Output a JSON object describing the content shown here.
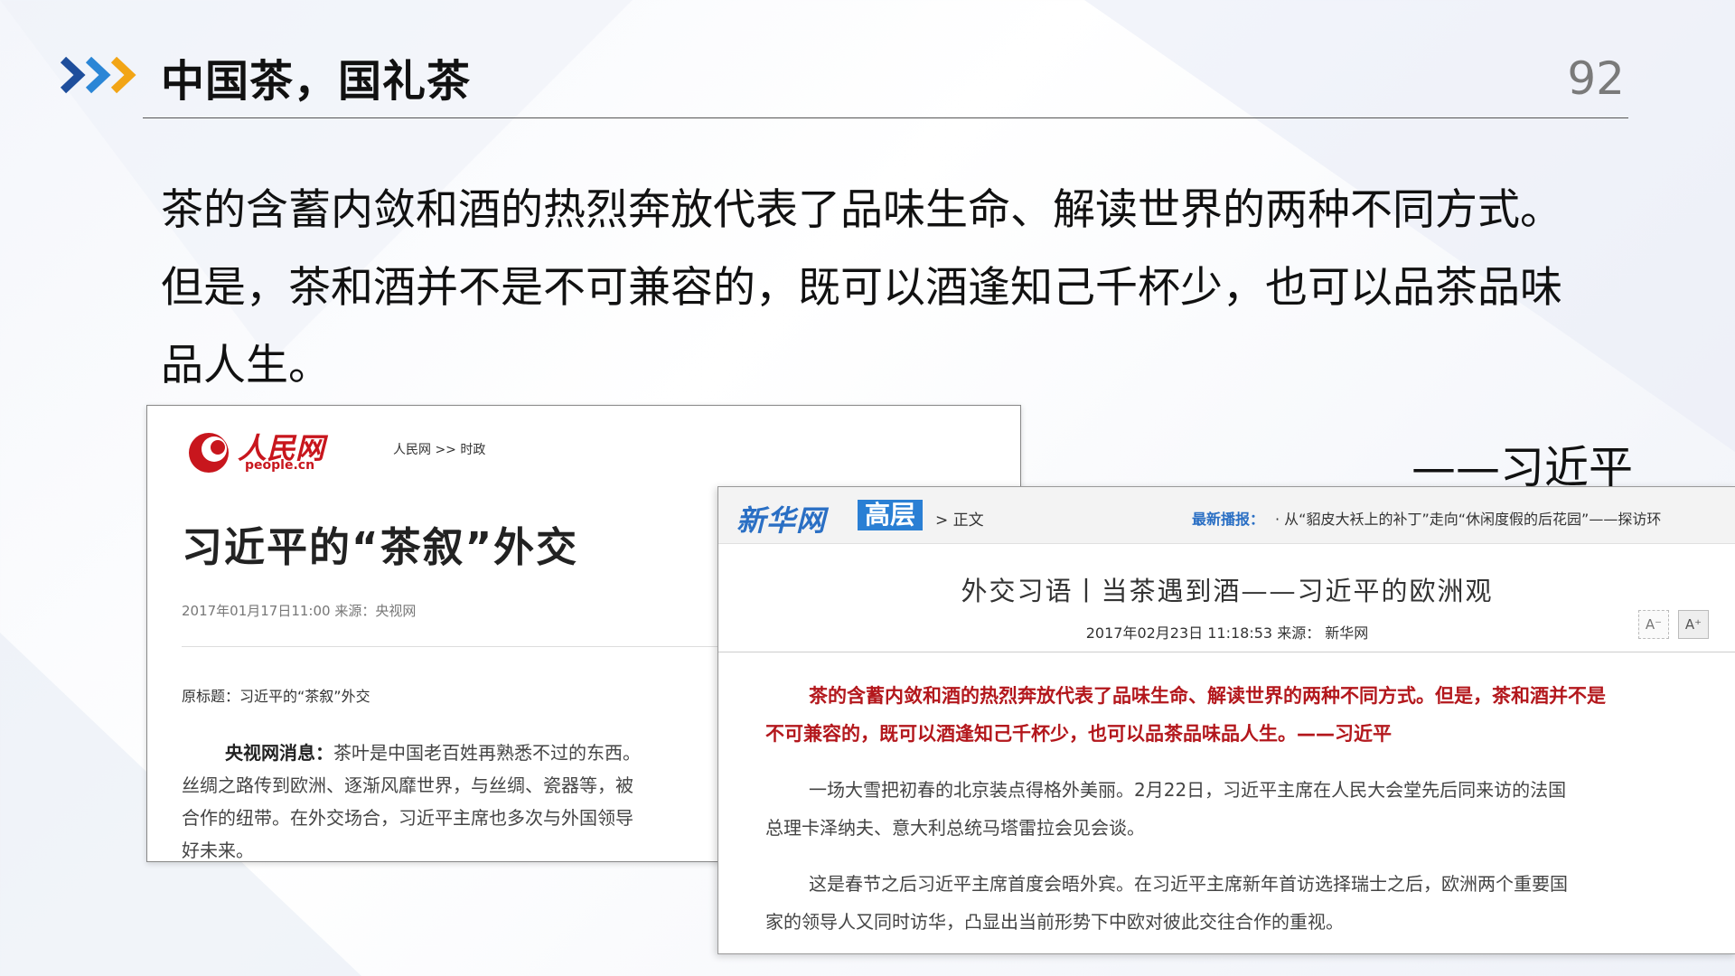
{
  "header": {
    "title": "中国茶，国礼茶",
    "page_number": "92"
  },
  "quote": {
    "line1": "茶的含蓄内敛和酒的热烈奔放代表了品味生命、解读世界的两种不同方式。",
    "line2": "但是，茶和酒并不是不可兼容的，既可以酒逢知己千杯少，也可以品茶品味",
    "line3": "品人生。",
    "attribution": "——习近平"
  },
  "people_card": {
    "logo_text": "人民网",
    "logo_domain": "people.cn",
    "breadcrumb": "人民网 >> 时政",
    "headline": "习近平的“茶叙”外交",
    "meta": "2017年01月17日11:00    来源：央视网",
    "original_title": "原标题：习近平的“茶叙”外交",
    "body_lead": "央视网消息：",
    "body_line1": "茶叶是中国老百姓再熟悉不过的东西。",
    "body_line2": "丝绸之路传到欧洲、逐渐风靡世界，与丝绸、瓷器等，被",
    "body_line3": "合作的纽带。在外交场合，习近平主席也多次与外国领导",
    "body_line4": "好未来。",
    "logo_color": "#c8161d"
  },
  "xinhua_card": {
    "logo": "新华网",
    "tag": "高层",
    "crumb": "> 正文",
    "news_label": "最新播报：",
    "news_text": "· 从“貂皮大袄上的补丁”走向“休闲度假的后花园”——探访环",
    "title": "外交习语丨当茶遇到酒——习近平的欧洲观",
    "meta": "2017年02月23日 11:18:53 来源： 新华网",
    "font_small": "A⁻",
    "font_big": "A⁺",
    "red_line1": "茶的含蓄内敛和酒的热烈奔放代表了品味生命、解读世界的两种不同方式。但是，茶和酒并不是",
    "red_line2": "不可兼容的，既可以酒逢知己千杯少，也可以品茶品味品人生。——习近平",
    "p1_line1": "一场大雪把初春的北京装点得格外美丽。2月22日，习近平主席在人民大会堂先后同来访的法国",
    "p1_line2": "总理卡泽纳夫、意大利总统马塔雷拉会见会谈。",
    "p2_line1": "这是春节之后习近平主席首度会晤外宾。在习近平主席新年首访选择瑞士之后，欧洲两个重要国",
    "p2_line2": "家的领导人又同时访华，凸显出当前形势下中欧对彼此交往合作的重视。",
    "accent_color": "#2a6fc4",
    "red_color": "#b3171c"
  }
}
